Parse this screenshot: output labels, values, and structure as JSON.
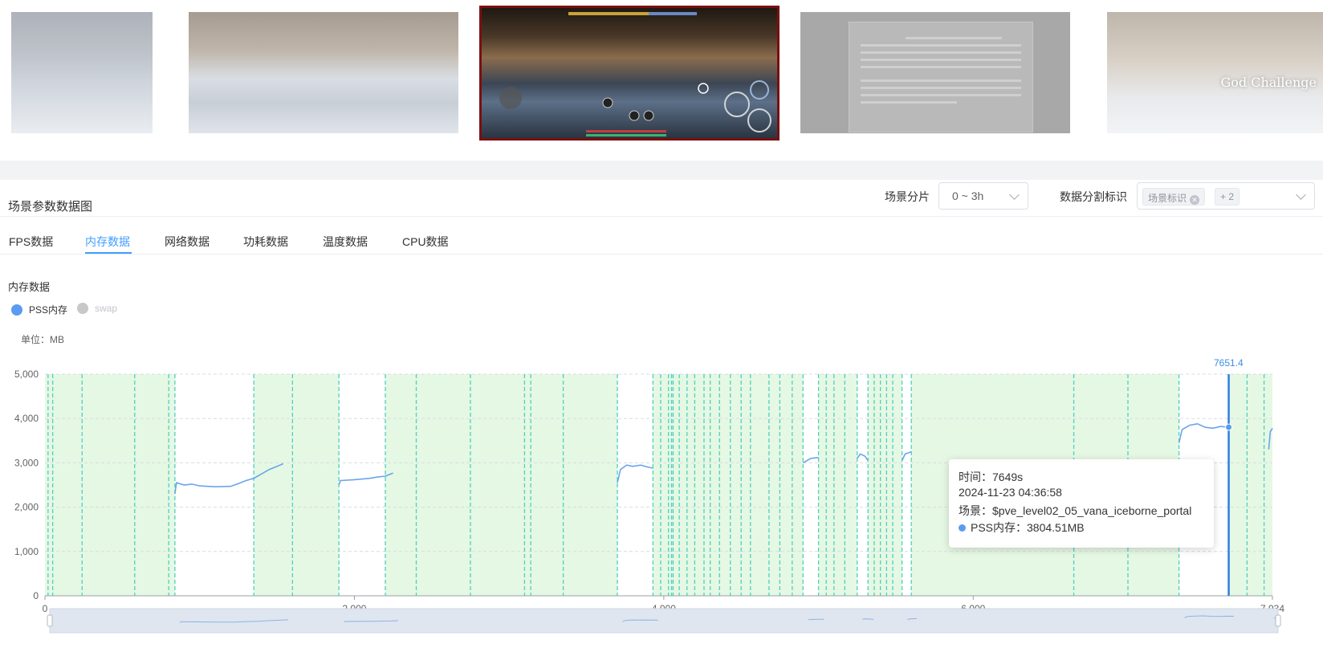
{
  "screenshots": [
    {
      "name": "thumb-1",
      "active": false
    },
    {
      "name": "thumb-2",
      "active": false
    },
    {
      "name": "thumb-3",
      "active": true
    },
    {
      "name": "thumb-4",
      "active": false
    },
    {
      "name": "thumb-5",
      "active": false,
      "overlay_text": "God Challenge"
    }
  ],
  "panel": {
    "title": "场景参数数据图",
    "slice_label": "场景分片",
    "slice_value": "0 ~ 3h",
    "split_label": "数据分割标识",
    "split_tag": "场景标识",
    "split_more": "+ 2"
  },
  "tabs": [
    {
      "label": "FPS数据",
      "active": false
    },
    {
      "label": "内存数据",
      "active": true
    },
    {
      "label": "网络数据",
      "active": false
    },
    {
      "label": "功耗数据",
      "active": false
    },
    {
      "label": "温度数据",
      "active": false
    },
    {
      "label": "CPU数据",
      "active": false
    }
  ],
  "section_title": "内存数据",
  "legend": [
    {
      "label": "PSS内存",
      "color": "#5b9bf0",
      "enabled": true
    },
    {
      "label": "swap",
      "color": "#c8c8c8",
      "enabled": false
    }
  ],
  "unit_label": "单位：MB",
  "marker_label": "7651.4",
  "tooltip": {
    "time": "时间：7649s",
    "datetime": "2024-11-23 04:36:58",
    "scene": "场景：$pve_level02_05_vana_iceborne_portal",
    "value": "PSS内存：3804.51MB"
  },
  "colors": {
    "accent": "#409eff",
    "line": "#6aa4ee",
    "band": "#e5f8e3",
    "divider": "#4fd0c0",
    "marker": "#2f7ee0"
  },
  "chart_data": {
    "type": "line",
    "title": "内存数据",
    "ylabel": "单位：MB",
    "xlabel": "",
    "xlim": [
      0,
      7934
    ],
    "ylim": [
      0,
      5000
    ],
    "x_ticks": [
      "0",
      "2,000",
      "4,000",
      "6,000",
      "7,934"
    ],
    "y_ticks": [
      "0",
      "1,000",
      "2,000",
      "3,000",
      "4,000",
      "5,000"
    ],
    "grid": true,
    "legend_position": "top-left",
    "series": [
      {
        "name": "PSS内存",
        "segments": [
          [
            [
              840,
              2300
            ],
            [
              850,
              2550
            ],
            [
              900,
              2500
            ],
            [
              950,
              2520
            ],
            [
              1000,
              2480
            ],
            [
              1100,
              2460
            ],
            [
              1200,
              2470
            ],
            [
              1250,
              2530
            ],
            [
              1300,
              2600
            ],
            [
              1350,
              2650
            ],
            [
              1400,
              2750
            ],
            [
              1450,
              2850
            ],
            [
              1500,
              2920
            ],
            [
              1540,
              2980
            ]
          ],
          [
            [
              1900,
              2500
            ],
            [
              1910,
              2600
            ],
            [
              2000,
              2620
            ],
            [
              2100,
              2650
            ],
            [
              2150,
              2680
            ],
            [
              2200,
              2700
            ],
            [
              2250,
              2770
            ]
          ],
          [
            [
              3700,
              2550
            ],
            [
              3720,
              2850
            ],
            [
              3760,
              2950
            ],
            [
              3800,
              2920
            ],
            [
              3850,
              2950
            ],
            [
              3900,
              2900
            ],
            [
              3930,
              2880
            ]
          ],
          [
            [
              4900,
              3000
            ],
            [
              4950,
              3100
            ],
            [
              5000,
              3120
            ]
          ],
          [
            [
              5250,
              3100
            ],
            [
              5270,
              3200
            ],
            [
              5300,
              3150
            ],
            [
              5320,
              3050
            ]
          ],
          [
            [
              5540,
              3050
            ],
            [
              5560,
              3200
            ],
            [
              5600,
              3250
            ]
          ],
          [
            [
              7330,
              3450
            ],
            [
              7350,
              3750
            ],
            [
              7400,
              3850
            ],
            [
              7450,
              3880
            ],
            [
              7500,
              3800
            ],
            [
              7550,
              3780
            ],
            [
              7600,
              3820
            ],
            [
              7649,
              3804.51
            ]
          ],
          [
            [
              7910,
              3300
            ],
            [
              7920,
              3700
            ],
            [
              7934,
              3780
            ]
          ]
        ]
      },
      {
        "name": "swap",
        "segments": []
      }
    ],
    "scene_bands": [
      [
        0,
        840
      ],
      [
        1350,
        1900
      ],
      [
        2200,
        3700
      ],
      [
        3930,
        4900
      ],
      [
        5000,
        5250
      ],
      [
        5320,
        5540
      ],
      [
        5600,
        7330
      ],
      [
        7649,
        7934
      ]
    ],
    "scene_dividers": [
      20,
      50,
      240,
      580,
      800,
      840,
      1350,
      1600,
      1900,
      2200,
      2400,
      2750,
      3100,
      3140,
      3350,
      3700,
      3930,
      3980,
      4030,
      4050,
      4060,
      4100,
      4150,
      4200,
      4260,
      4300,
      4360,
      4430,
      4500,
      4560,
      4680,
      4750,
      4830,
      4900,
      5000,
      5050,
      5100,
      5170,
      5250,
      5320,
      5360,
      5400,
      5440,
      5480,
      5540,
      5600,
      6650,
      7000,
      7330,
      7770,
      7880
    ],
    "marker": {
      "x": 7651.4,
      "label": "7651.4",
      "point_value": 3804.51
    }
  }
}
